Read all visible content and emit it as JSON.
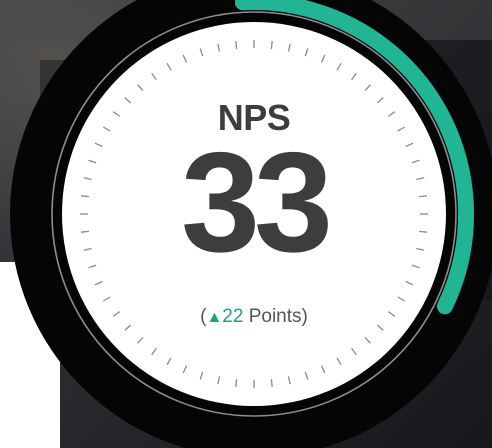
{
  "gauge": {
    "title": "NPS",
    "value": "33",
    "change": {
      "open_paren": "(",
      "arrow": "▲",
      "amount": "22",
      "unit_text": " Points)"
    },
    "progress_fraction": 0.33,
    "colors": {
      "accent": "#1fb595",
      "text": "#3d3d3d",
      "face": "#ffffff",
      "outer_ring": "#050505",
      "tick": "#8a8a8a"
    }
  }
}
